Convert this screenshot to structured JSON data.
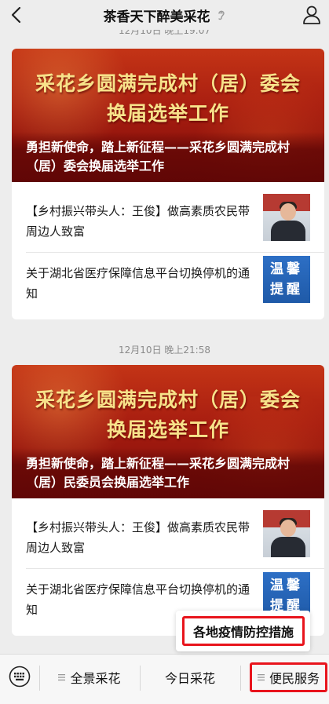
{
  "header": {
    "title": "茶香天下醉美采花",
    "back_icon": "back-arrow-icon",
    "ear_icon": "ear-icon",
    "user_icon": "user-icon"
  },
  "timestamps": {
    "top_partial": "12月10日 晚上19:07",
    "second": "12月10日 晚上21:58"
  },
  "messages": [
    {
      "banner_title_line1": "采花乡圆满完成村（居）委会",
      "banner_title_line2": "换届选举工作",
      "banner_caption": "勇担新使命，踏上新征程——采花乡圆满完成村（居）委会换届选举工作",
      "items": [
        {
          "text": "【乡村振兴带头人：王俊】做高素质农民带周边人致富",
          "thumb": "person-photo"
        },
        {
          "text": "关于湖北省医疗保障信息平台切换停机的通知",
          "thumb": "notice",
          "thumb_text": "温馨提醒"
        }
      ]
    },
    {
      "banner_title_line1": "采花乡圆满完成村（居）委会",
      "banner_title_line2": "换届选举工作",
      "banner_caption": "勇担新使命，踏上新征程——采花乡圆满完成村（居）民委员会换届选举工作",
      "items": [
        {
          "text": "【乡村振兴带头人：王俊】做高素质农民带周边人致富",
          "thumb": "person-photo"
        },
        {
          "text": "关于湖北省医疗保障信息平台切换停机的通知",
          "thumb": "notice",
          "thumb_text": "温馨提醒"
        }
      ]
    }
  ],
  "popup": {
    "item": "各地疫情防控措施"
  },
  "bottom_menu": {
    "keyboard_icon": "keyboard-icon",
    "items": [
      {
        "label": "全景采花",
        "has_submenu": true
      },
      {
        "label": "今日采花",
        "has_submenu": false
      },
      {
        "label": "便民服务",
        "has_submenu": true
      }
    ]
  },
  "colors": {
    "highlight": "#e8141c",
    "banner": "#a71d10",
    "banner_title": "#f7e28a",
    "notice_blue": "#2d6fc5",
    "background": "#ededed"
  }
}
